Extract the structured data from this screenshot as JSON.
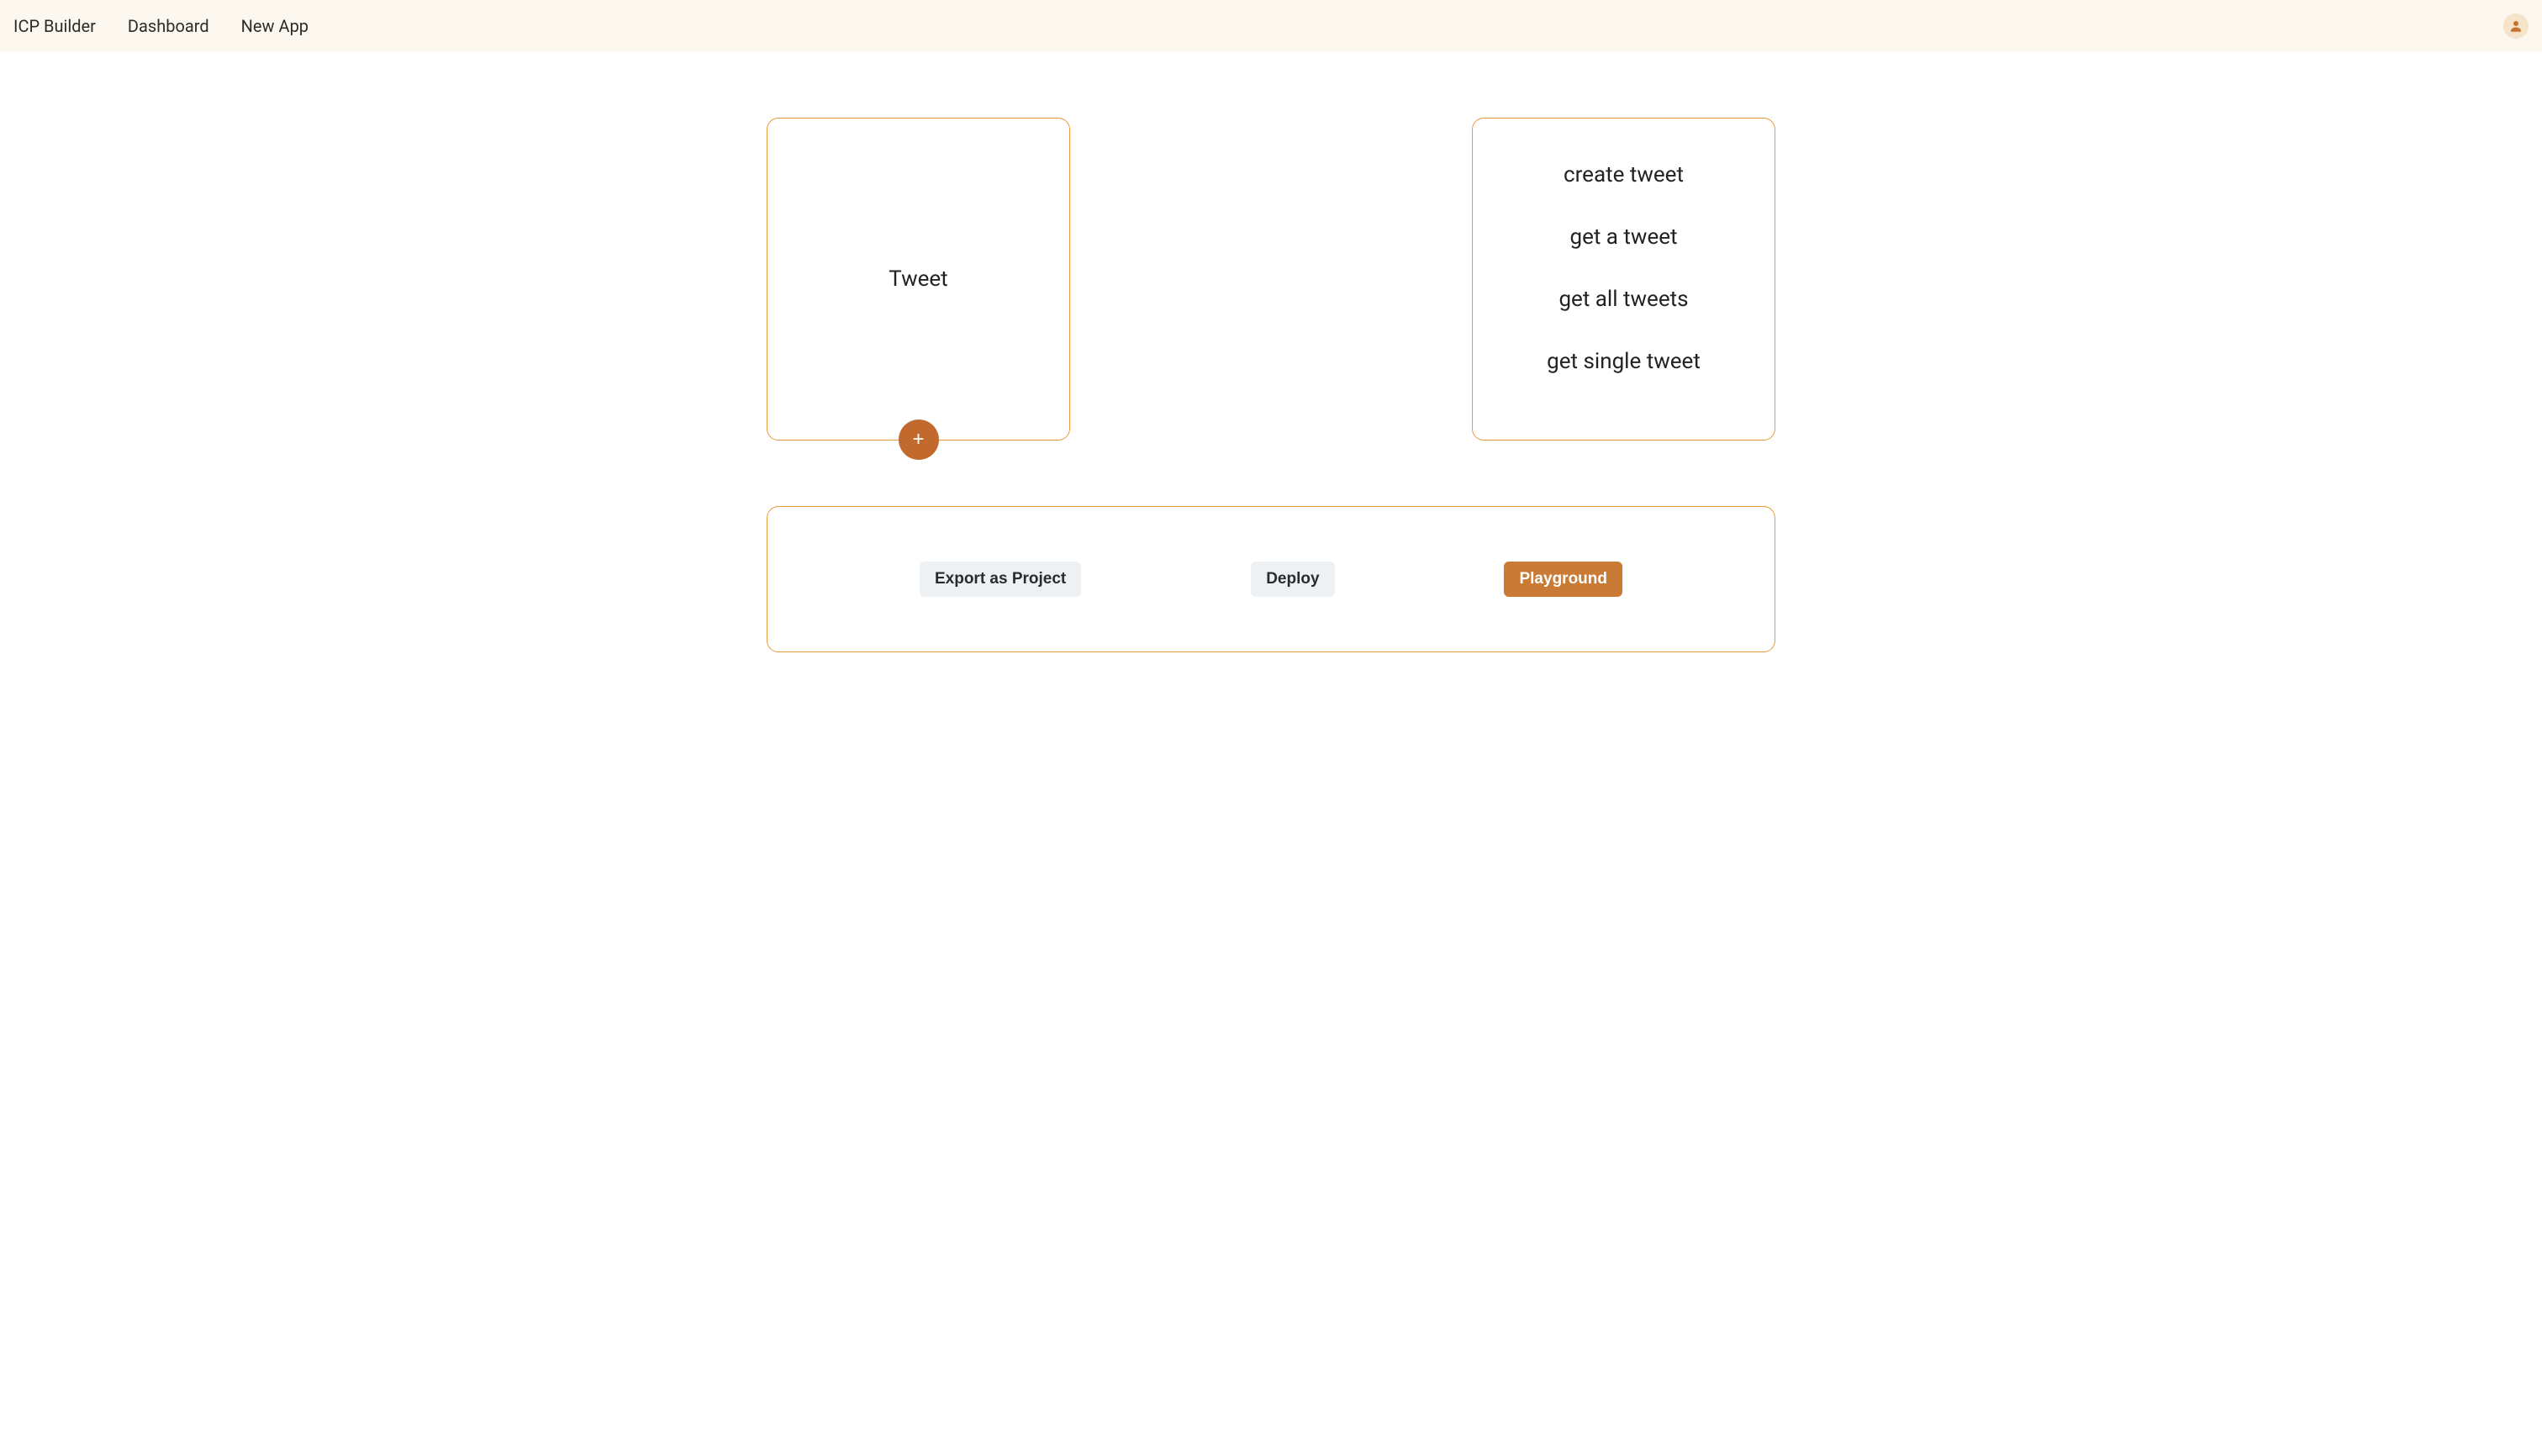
{
  "topbar": {
    "title": "ICP Builder",
    "links": [
      {
        "label": "Dashboard"
      },
      {
        "label": "New App"
      }
    ]
  },
  "entity_card": {
    "name": "Tweet",
    "add_label": "+"
  },
  "methods_card": {
    "items": [
      {
        "label": "create tweet"
      },
      {
        "label": "get a tweet"
      },
      {
        "label": "get all tweets"
      },
      {
        "label": "get single tweet"
      }
    ]
  },
  "actions": {
    "export_label": "Export as Project",
    "deploy_label": "Deploy",
    "playground_label": "Playground"
  }
}
